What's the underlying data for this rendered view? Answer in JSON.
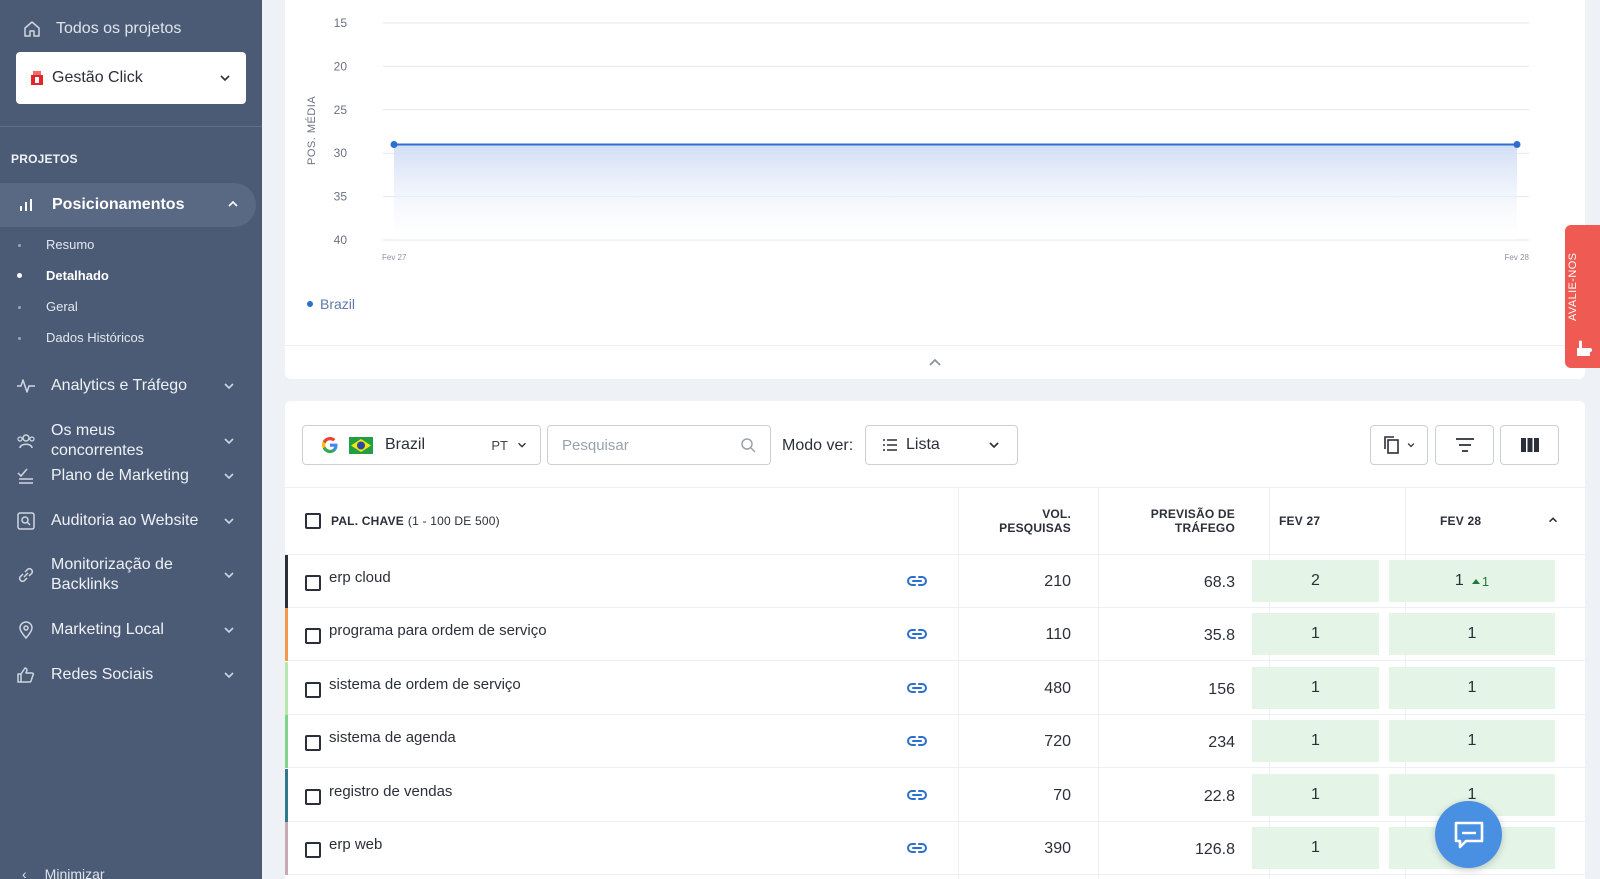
{
  "sidebar": {
    "all_projects": "Todos os projetos",
    "project": "Gestão Click",
    "section_title": "PROJETOS",
    "active_item": "Posicionamentos",
    "sub_items": [
      "Resumo",
      "Detalhado",
      "Geral",
      "Dados Históricos"
    ],
    "active_sub_index": 1,
    "items": [
      {
        "label": "Analytics e Tráfego",
        "icon": "pulse-icon"
      },
      {
        "label": "Os meus concorrentes",
        "icon": "users-icon"
      },
      {
        "label": "Plano de Marketing",
        "icon": "checklist-icon"
      },
      {
        "label": "Auditoria ao Website",
        "icon": "audit-icon"
      },
      {
        "label": "Monitorização de Backlinks",
        "icon": "link-icon"
      },
      {
        "label": "Marketing Local",
        "icon": "location-pin-icon"
      },
      {
        "label": "Redes Sociais",
        "icon": "thumbs-up-icon"
      }
    ],
    "minimize": "Minimizar"
  },
  "chart_data": {
    "type": "line",
    "title": "",
    "xlabel": "",
    "ylabel": "POS. MÉDIA",
    "x": [
      "Fev 27",
      "Fev 28"
    ],
    "ylim": [
      15,
      40
    ],
    "y_inverted": true,
    "y_ticks": [
      15,
      20,
      25,
      30,
      35,
      40
    ],
    "series": [
      {
        "name": "Brazil",
        "values": [
          29,
          29
        ]
      }
    ],
    "legend": "bottom-left",
    "grid": true,
    "colors": {
      "line": "#2d6fd1",
      "fill": "#dbe6f8"
    }
  },
  "review_tab": "AVALIE-NOS",
  "toolbar": {
    "country": "Brazil",
    "language": "PT",
    "search_placeholder": "Pesquisar",
    "mode_label": "Modo ver:",
    "mode_value": "Lista"
  },
  "table": {
    "headers": {
      "keyword": "PAL. CHAVE",
      "keyword_count": "(1 - 100 DE 500)",
      "volume_1": "VOL.",
      "volume_2": "PESQUISAS",
      "traffic_1": "PREVISÃO DE",
      "traffic_2": "TRÁFEGO",
      "date1": "FEV 27",
      "date2": "FEV 28"
    },
    "rows": [
      {
        "keyword": "erp cloud",
        "volume": "210",
        "traffic": "68.3",
        "fev27": "2",
        "fev28": "1",
        "change": "1",
        "accent": "#2b2f38"
      },
      {
        "keyword": "programa para ordem de serviço",
        "volume": "110",
        "traffic": "35.8",
        "fev27": "1",
        "fev28": "1",
        "change": "",
        "accent": "#f29a4a"
      },
      {
        "keyword": "sistema de ordem de serviço",
        "volume": "480",
        "traffic": "156",
        "fev27": "1",
        "fev28": "1",
        "change": "",
        "accent": "#b8e8b0"
      },
      {
        "keyword": "sistema de agenda",
        "volume": "720",
        "traffic": "234",
        "fev27": "1",
        "fev28": "1",
        "change": "",
        "accent": "#7ed58a"
      },
      {
        "keyword": "registro de vendas",
        "volume": "70",
        "traffic": "22.8",
        "fev27": "1",
        "fev28": "1",
        "change": "",
        "accent": "#2f7b8c"
      },
      {
        "keyword": "erp web",
        "volume": "390",
        "traffic": "126.8",
        "fev27": "1",
        "fev28": "",
        "change": "",
        "accent": "#c9a9b3"
      }
    ]
  }
}
